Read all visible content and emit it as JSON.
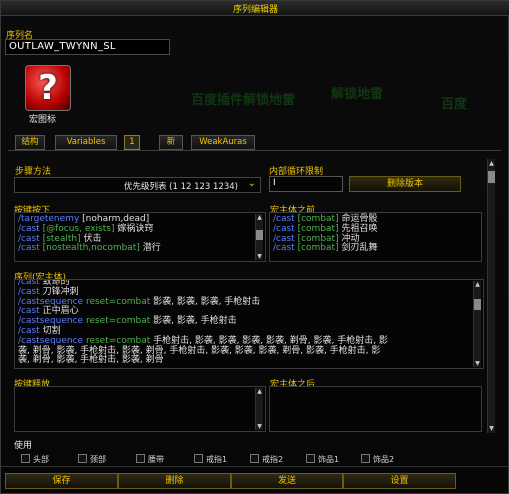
{
  "window": {
    "title": "序列编辑器"
  },
  "watermarks": [
    "百度插件解锁地雷",
    "解锁地雷",
    "百度"
  ],
  "sequence": {
    "name_label": "序列名",
    "name_value": "OUTLAW_TWYNN_SL",
    "icon_label": "宏图标",
    "icon_glyph": "?"
  },
  "tabs": [
    {
      "label": "结构"
    },
    {
      "label": "Variables"
    },
    {
      "label": "1"
    },
    {
      "label": "新"
    },
    {
      "label": "WeakAuras"
    }
  ],
  "step": {
    "label": "步骤方法",
    "value": "优先级列表 (1 12 123 1234)",
    "chevron": "chevron-down-icon"
  },
  "loop": {
    "label": "内部循环限制",
    "value": "I",
    "delete_version_label": "删除版本"
  },
  "keypress": {
    "label": "按键按下",
    "lines": [
      [
        {
          "c": "cmd",
          "t": "/targetenemy"
        },
        {
          "c": "txt",
          "t": " [noharm,dead]"
        }
      ],
      [
        {
          "c": "cmd",
          "t": "/cast"
        },
        {
          "c": "kw",
          "t": " [@focus, exists]"
        },
        {
          "c": "txt",
          "t": " 嫁祸诀窍"
        }
      ],
      [
        {
          "c": "cmd",
          "t": "/cast"
        },
        {
          "c": "kw",
          "t": " [stealth]"
        },
        {
          "c": "txt",
          "t": " 伏击"
        }
      ],
      [
        {
          "c": "cmd",
          "t": "/cast"
        },
        {
          "c": "kw",
          "t": " [nostealth,nocombat]"
        },
        {
          "c": "txt",
          "t": " 潜行"
        }
      ]
    ]
  },
  "prebody": {
    "label": "宏主体之前",
    "lines": [
      [
        {
          "c": "cmd",
          "t": "/cast"
        },
        {
          "c": "kw",
          "t": " [combat]"
        },
        {
          "c": "txt",
          "t": " 命运骨骰"
        }
      ],
      [
        {
          "c": "cmd",
          "t": "/cast"
        },
        {
          "c": "kw",
          "t": " [combat]"
        },
        {
          "c": "txt",
          "t": " 先祖召唤"
        }
      ],
      [
        {
          "c": "cmd",
          "t": "/cast"
        },
        {
          "c": "kw",
          "t": " [combat]"
        },
        {
          "c": "txt",
          "t": " 冲动"
        }
      ],
      [
        {
          "c": "cmd",
          "t": "/cast"
        },
        {
          "c": "kw",
          "t": " [combat]"
        },
        {
          "c": "txt",
          "t": " 剑刃乱舞"
        }
      ]
    ]
  },
  "body": {
    "label": "序列(宏主体)",
    "lines": [
      [
        {
          "c": "cmd",
          "t": "/cast"
        },
        {
          "c": "txt",
          "t": " 致命的"
        }
      ],
      [
        {
          "c": "cmd",
          "t": "/cast"
        },
        {
          "c": "txt",
          "t": " 刀锋冲刺"
        }
      ],
      [
        {
          "c": "cmd",
          "t": "/castsequence"
        },
        {
          "c": "kw",
          "t": "  reset=combat"
        },
        {
          "c": "txt",
          "t": "  影袭, 影袭, 影袭, 手枪射击"
        }
      ],
      [
        {
          "c": "cmd",
          "t": "/cast"
        },
        {
          "c": "txt",
          "t": " 正中眉心"
        }
      ],
      [
        {
          "c": "cmd",
          "t": "/castsequence"
        },
        {
          "c": "kw",
          "t": "  reset=combat"
        },
        {
          "c": "txt",
          "t": "  影袭, 影袭, 手枪射击"
        }
      ],
      [
        {
          "c": "cmd",
          "t": "/cast"
        },
        {
          "c": "txt",
          "t": " 切割"
        }
      ],
      [
        {
          "c": "cmd",
          "t": "/castsequence"
        },
        {
          "c": "kw",
          "t": "  reset=combat"
        },
        {
          "c": "txt",
          "t": "  手枪射击, 影袭, 影袭, 影袭, 影袭, 剃骨, 影袭, 手枪射击, 影"
        }
      ],
      [
        {
          "c": "txt",
          "t": "袭, 剃骨, 影袭, 手枪射击, 影袭, 剃骨, 手枪射击, 影袭, 影袭, 影袭, 剃骨, 影袭, 手枪射击, 影"
        }
      ],
      [
        {
          "c": "txt",
          "t": "袭, 剃骨, 影袭, 手枪射击, 影袭, 剃骨"
        }
      ]
    ]
  },
  "keyrelease": {
    "label": "按键释放"
  },
  "postbody": {
    "label": "宏主体之后"
  },
  "use": {
    "label": "使用",
    "checks": [
      "头部",
      "颈部",
      "腰带",
      "戒指1",
      "戒指2",
      "饰品1",
      "饰品2"
    ]
  },
  "buttons": {
    "save": "保存",
    "delete": "删除",
    "send": "发送",
    "settings": "设置"
  }
}
